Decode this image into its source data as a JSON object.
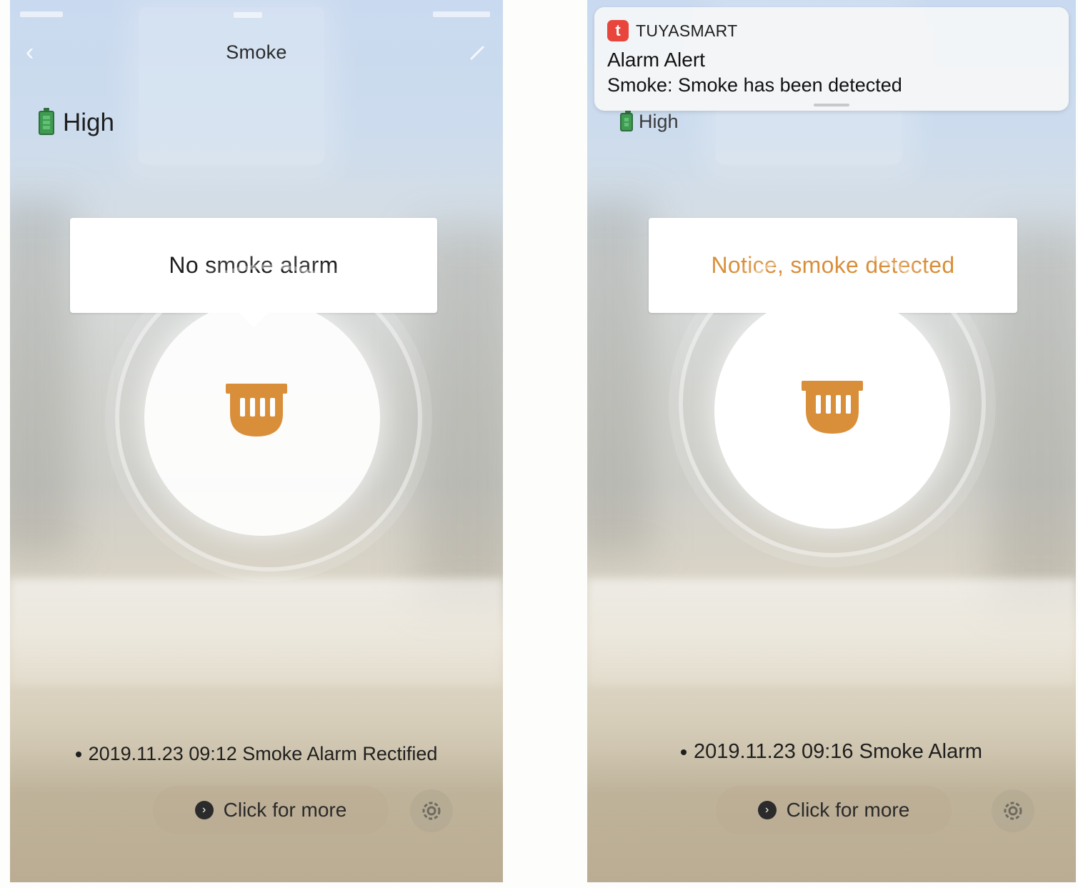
{
  "colors": {
    "detector_icon": "#d98f3a",
    "alarm_text": "#d98f3a",
    "battery_green": "#3f9a52",
    "notification_app_icon": "#e8453c"
  },
  "left_screen": {
    "title": "Smoke",
    "battery_label": "High",
    "status_text": "No smoke alarm",
    "status_color": "#1f1f1f",
    "log_entry": "2019.11.23 09:12 Smoke Alarm Rectified",
    "more_label": "Click for more",
    "icons": [
      "back-icon",
      "edit-icon",
      "battery-icon",
      "smoke-detector-icon",
      "info-icon",
      "settings-icon"
    ]
  },
  "right_screen": {
    "notification": {
      "app_name": "TUYASMART",
      "title": "Alarm Alert",
      "body": "Smoke: Smoke has been detected"
    },
    "battery_label": "High",
    "status_text": "Notice, smoke detected",
    "status_color": "#d98f3a",
    "log_entry": "2019.11.23 09:16 Smoke Alarm",
    "more_label": "Click for more",
    "icons": [
      "app-icon",
      "battery-icon",
      "smoke-detector-icon",
      "info-icon",
      "settings-icon"
    ]
  }
}
